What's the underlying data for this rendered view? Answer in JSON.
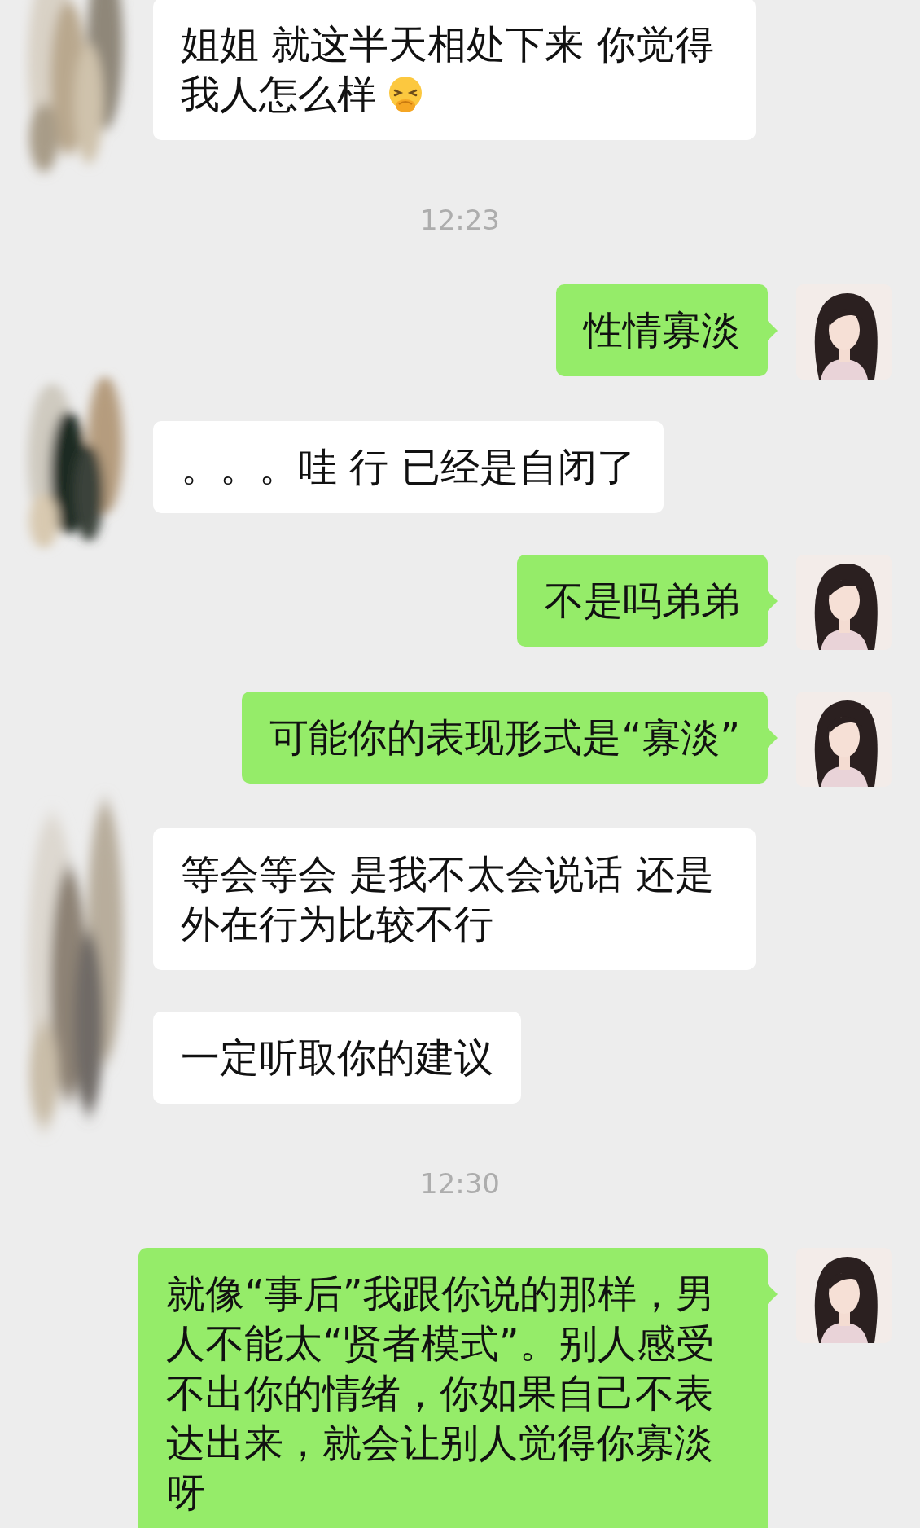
{
  "messages": [
    {
      "kind": "received",
      "bubbles": [
        {
          "text": "姐姐 就这半天相处下来 你觉得我人怎么样",
          "emoji": true
        }
      ]
    },
    {
      "kind": "time",
      "text": "12:23"
    },
    {
      "kind": "sent",
      "text": "性情寡淡"
    },
    {
      "kind": "received",
      "bubbles": [
        {
          "text": "。。。哇 行 已经是自闭了",
          "emoji": false
        }
      ]
    },
    {
      "kind": "sent",
      "text": "不是吗弟弟"
    },
    {
      "kind": "sent",
      "text": "可能你的表现形式是“寡淡”"
    },
    {
      "kind": "received",
      "bubbles": [
        {
          "text": "等会等会 是我不太会说话 还是外在行为比较不行",
          "emoji": false
        },
        {
          "text": "一定听取你的建议",
          "emoji": false
        }
      ]
    },
    {
      "kind": "time",
      "text": "12:30"
    },
    {
      "kind": "sent",
      "text": "就像“事后”我跟你说的那样，男人不能太“贤者模式”。别人感受不出你的情绪，你如果自己不表达出来，就会让别人觉得你寡淡呀"
    }
  ]
}
